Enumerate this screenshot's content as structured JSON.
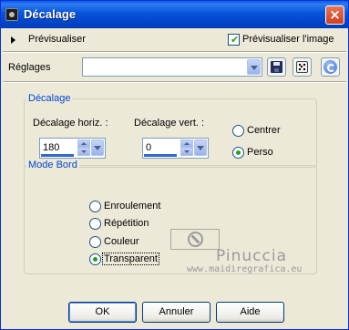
{
  "window": {
    "title": "Décalage",
    "close_glyph": "×"
  },
  "preview": {
    "label": "Prévisualiser",
    "checkbox_label": "Prévisualiser l'image",
    "checkbox_checked": true
  },
  "presets": {
    "label": "Réglages",
    "value": ""
  },
  "offset_group": {
    "title": "Décalage",
    "horiz_label": "Décalage horiz. :",
    "horiz_value": "180",
    "vert_label": "Décalage vert. :",
    "vert_value": "0",
    "center_label": "Centrer",
    "custom_label": "Perso",
    "selected": "Perso"
  },
  "edge_group": {
    "title": "Mode Bord",
    "options": [
      "Enroulement",
      "Répétition",
      "Couleur",
      "Transparent"
    ],
    "selected": "Transparent"
  },
  "watermark": {
    "name": "Pinuccia",
    "url": "www.maidiregrafica.eu"
  },
  "buttons": {
    "ok": "OK",
    "cancel": "Annuler",
    "help": "Aide"
  },
  "icons": [
    "save-icon",
    "random-dice-icon",
    "reset-icon",
    "no-entry-icon"
  ]
}
